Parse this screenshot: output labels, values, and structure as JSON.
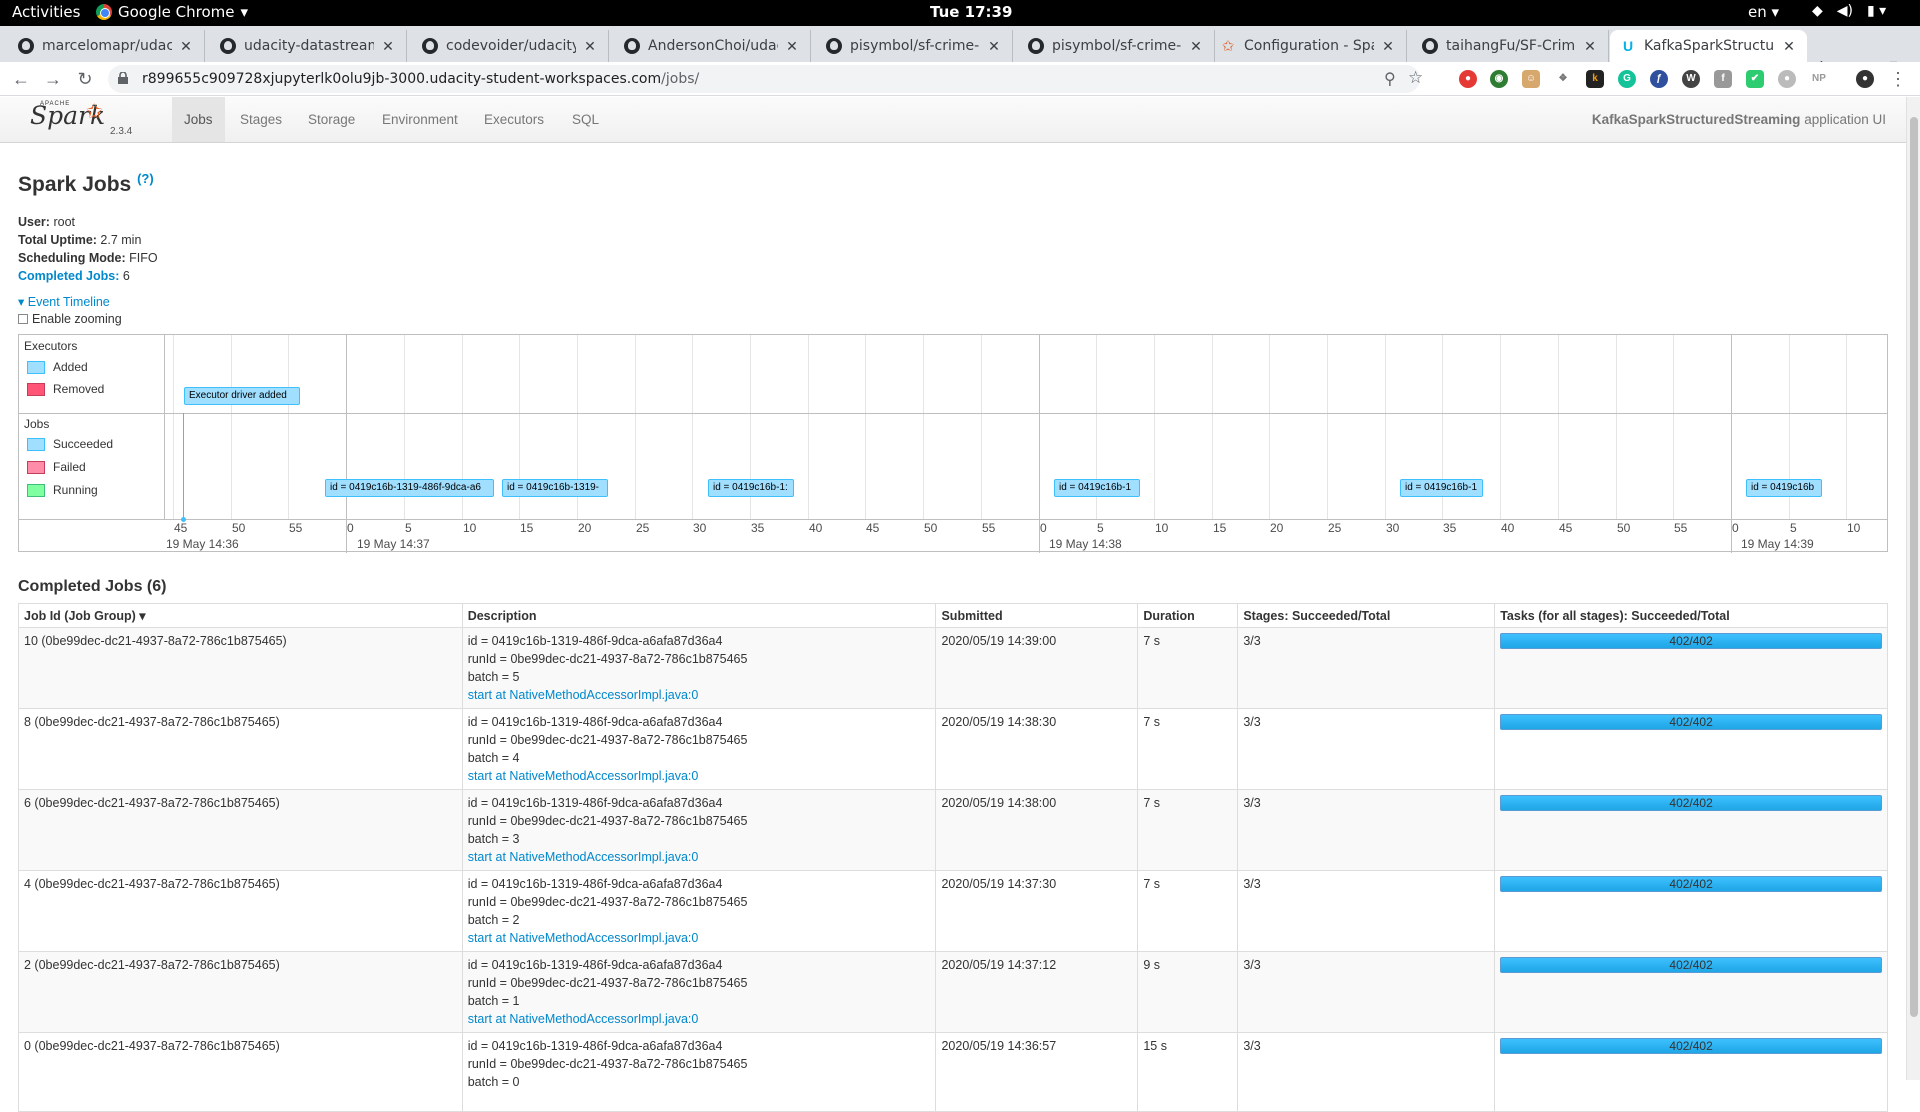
{
  "gnome": {
    "activities": "Activities",
    "app_name": "Google Chrome",
    "clock": "Tue 17:39",
    "lang": "en"
  },
  "tabs": [
    {
      "label": "marcelomapr/udacity",
      "icon": "github-icon"
    },
    {
      "label": "udacity-datastreamin",
      "icon": "github-icon"
    },
    {
      "label": "codevoider/udacity-d",
      "icon": "github-icon"
    },
    {
      "label": "AndersonChoi/udacit",
      "icon": "github-icon"
    },
    {
      "label": "pisymbol/sf-crime-st",
      "icon": "github-icon"
    },
    {
      "label": "pisymbol/sf-crime-st",
      "icon": "github-icon"
    },
    {
      "label": "Configuration - Spar",
      "icon": "spark-icon"
    },
    {
      "label": "taihangFu/SF-Crime-",
      "icon": "github-icon"
    },
    {
      "label": "KafkaSparkStructure",
      "icon": "udacity-icon",
      "active": true
    }
  ],
  "address": {
    "host": "r899655c909728xjupyterlk0olu9jb-3000.udacity-student-workspaces.com",
    "path": "/jobs/"
  },
  "spark": {
    "version": "2.3.4",
    "nav": [
      "Jobs",
      "Stages",
      "Storage",
      "Environment",
      "Executors",
      "SQL"
    ],
    "app_name": "KafkaSparkStructuredStreaming",
    "app_suffix": " application UI"
  },
  "page": {
    "title": "Spark Jobs",
    "help": "(?)",
    "user_label": "User:",
    "user": "root",
    "uptime_label": "Total Uptime:",
    "uptime": "2.7 min",
    "sched_label": "Scheduling Mode:",
    "sched": "FIFO",
    "completed_label": "Completed Jobs:",
    "completed": "6",
    "event_timeline": "Event Timeline",
    "enable_zooming": "Enable zooming"
  },
  "timeline": {
    "executors_label": "Executors",
    "added": "Added",
    "removed": "Removed",
    "jobs_label": "Jobs",
    "succeeded": "Succeeded",
    "failed": "Failed",
    "running": "Running",
    "executor_box": "Executor driver added",
    "job_boxes": [
      "id = 0419c16b-1319-486f-9dca-a6",
      "id = 0419c16b-1319-",
      "id = 0419c16b-1:",
      "id = 0419c16b-1",
      "id = 0419c16b-1",
      "id = 0419c16b"
    ],
    "ticks": [
      "45",
      "50",
      "55",
      "0",
      "5",
      "10",
      "15",
      "20",
      "25",
      "30",
      "35",
      "40",
      "45",
      "50",
      "55",
      "0",
      "5",
      "10",
      "15",
      "20",
      "25",
      "30",
      "35",
      "40",
      "45",
      "50",
      "55",
      "0",
      "5",
      "10"
    ],
    "major_labels": [
      "19 May 14:36",
      "19 May 14:37",
      "19 May 14:38",
      "19 May 14:39"
    ],
    "colors": {
      "succeeded": "#a0dfff",
      "failed": "#ff8ca8",
      "running": "#80ffa0"
    }
  },
  "completed_section": {
    "title": "Completed Jobs (6)",
    "headers": [
      "Job Id (Job Group) ▾",
      "Description",
      "Submitted",
      "Duration",
      "Stages: Succeeded/Total",
      "Tasks (for all stages): Succeeded/Total"
    ],
    "rows": [
      {
        "id": "10 (0be99dec-dc21-4937-8a72-786c1b875465)",
        "d1": "id = 0419c16b-1319-486f-9dca-a6afa87d36a4",
        "d2": "runId = 0be99dec-dc21-4937-8a72-786c1b875465",
        "d3": "batch = 5",
        "link": "start at NativeMethodAccessorImpl.java:0",
        "submitted": "2020/05/19 14:39:00",
        "duration": "7 s",
        "stages": "3/3",
        "tasks": "402/402"
      },
      {
        "id": "8 (0be99dec-dc21-4937-8a72-786c1b875465)",
        "d1": "id = 0419c16b-1319-486f-9dca-a6afa87d36a4",
        "d2": "runId = 0be99dec-dc21-4937-8a72-786c1b875465",
        "d3": "batch = 4",
        "link": "start at NativeMethodAccessorImpl.java:0",
        "submitted": "2020/05/19 14:38:30",
        "duration": "7 s",
        "stages": "3/3",
        "tasks": "402/402"
      },
      {
        "id": "6 (0be99dec-dc21-4937-8a72-786c1b875465)",
        "d1": "id = 0419c16b-1319-486f-9dca-a6afa87d36a4",
        "d2": "runId = 0be99dec-dc21-4937-8a72-786c1b875465",
        "d3": "batch = 3",
        "link": "start at NativeMethodAccessorImpl.java:0",
        "submitted": "2020/05/19 14:38:00",
        "duration": "7 s",
        "stages": "3/3",
        "tasks": "402/402"
      },
      {
        "id": "4 (0be99dec-dc21-4937-8a72-786c1b875465)",
        "d1": "id = 0419c16b-1319-486f-9dca-a6afa87d36a4",
        "d2": "runId = 0be99dec-dc21-4937-8a72-786c1b875465",
        "d3": "batch = 2",
        "link": "start at NativeMethodAccessorImpl.java:0",
        "submitted": "2020/05/19 14:37:30",
        "duration": "7 s",
        "stages": "3/3",
        "tasks": "402/402"
      },
      {
        "id": "2 (0be99dec-dc21-4937-8a72-786c1b875465)",
        "d1": "id = 0419c16b-1319-486f-9dca-a6afa87d36a4",
        "d2": "runId = 0be99dec-dc21-4937-8a72-786c1b875465",
        "d3": "batch = 1",
        "link": "start at NativeMethodAccessorImpl.java:0",
        "submitted": "2020/05/19 14:37:12",
        "duration": "9 s",
        "stages": "3/3",
        "tasks": "402/402"
      },
      {
        "id": "0 (0be99dec-dc21-4937-8a72-786c1b875465)",
        "d1": "id = 0419c16b-1319-486f-9dca-a6afa87d36a4",
        "d2": "runId = 0be99dec-dc21-4937-8a72-786c1b875465",
        "d3": "batch = 0",
        "link": "",
        "submitted": "2020/05/19 14:36:57",
        "duration": "15 s",
        "stages": "3/3",
        "tasks": "402/402"
      }
    ]
  }
}
